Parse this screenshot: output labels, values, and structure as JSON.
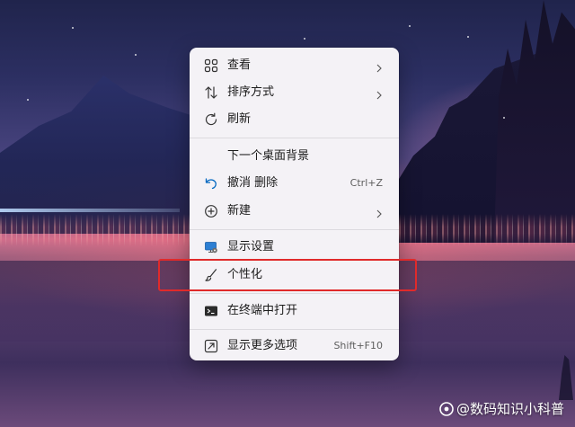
{
  "context_menu": {
    "items": [
      {
        "label": "查看",
        "icon": "grid-view-icon",
        "has_submenu": true
      },
      {
        "label": "排序方式",
        "icon": "sort-arrows-icon",
        "has_submenu": true
      },
      {
        "label": "刷新",
        "icon": "refresh-icon"
      },
      {
        "label": "下一个桌面背景"
      },
      {
        "label": "撤消 删除",
        "icon": "undo-icon",
        "shortcut": "Ctrl+Z"
      },
      {
        "label": "新建",
        "icon": "plus-circle-icon",
        "has_submenu": true
      },
      {
        "label": "显示设置",
        "icon": "display-settings-icon"
      },
      {
        "label": "个性化",
        "icon": "paintbrush-icon",
        "highlighted": true
      },
      {
        "label": "在终端中打开",
        "icon": "terminal-icon"
      },
      {
        "label": "显示更多选项",
        "icon": "more-options-icon",
        "shortcut": "Shift+F10"
      }
    ]
  },
  "highlight_color": "#e02a2a",
  "accent_color": "#0067c0",
  "watermark": {
    "text": "@数码知识小科普",
    "icon": "toutiao-logo-icon"
  }
}
